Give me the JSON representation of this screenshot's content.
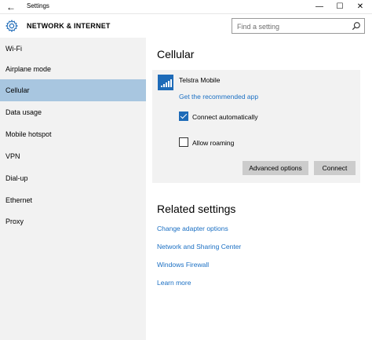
{
  "window": {
    "title": "Settings",
    "back_glyph": "←",
    "minimize_glyph": "—",
    "maximize_glyph": "☐",
    "close_glyph": "✕"
  },
  "header": {
    "title": "NETWORK & INTERNET",
    "search_placeholder": "Find a setting"
  },
  "sidebar": {
    "items": [
      {
        "label": "Wi-Fi",
        "selected": false
      },
      {
        "label": "Airplane mode",
        "selected": false
      },
      {
        "label": "Cellular",
        "selected": true
      },
      {
        "label": "Data usage",
        "selected": false
      },
      {
        "label": "Mobile hotspot",
        "selected": false
      },
      {
        "label": "VPN",
        "selected": false
      },
      {
        "label": "Dial-up",
        "selected": false
      },
      {
        "label": "Ethernet",
        "selected": false
      },
      {
        "label": "Proxy",
        "selected": false
      }
    ]
  },
  "main": {
    "title": "Cellular",
    "card": {
      "carrier": "Telstra Mobile",
      "recommended_app_link": "Get the recommended app",
      "connect_automatically": {
        "label": "Connect automatically",
        "checked": true
      },
      "allow_roaming": {
        "label": "Allow roaming",
        "checked": false
      },
      "advanced_button": "Advanced options",
      "connect_button": "Connect"
    },
    "related": {
      "title": "Related settings",
      "links": [
        "Change adapter options",
        "Network and Sharing Center",
        "Windows Firewall",
        "Learn more"
      ]
    }
  },
  "colors": {
    "accent": "#1e6bb8",
    "link": "#1a6fc3",
    "selected_nav": "#a8c6e0",
    "sidebar_bg": "#f2f2f2",
    "button_bg": "#cccccc"
  },
  "icons": {
    "back": "back-arrow-icon",
    "gear": "gear-icon",
    "search": "search-icon",
    "signal": "cellular-signal-icon"
  }
}
